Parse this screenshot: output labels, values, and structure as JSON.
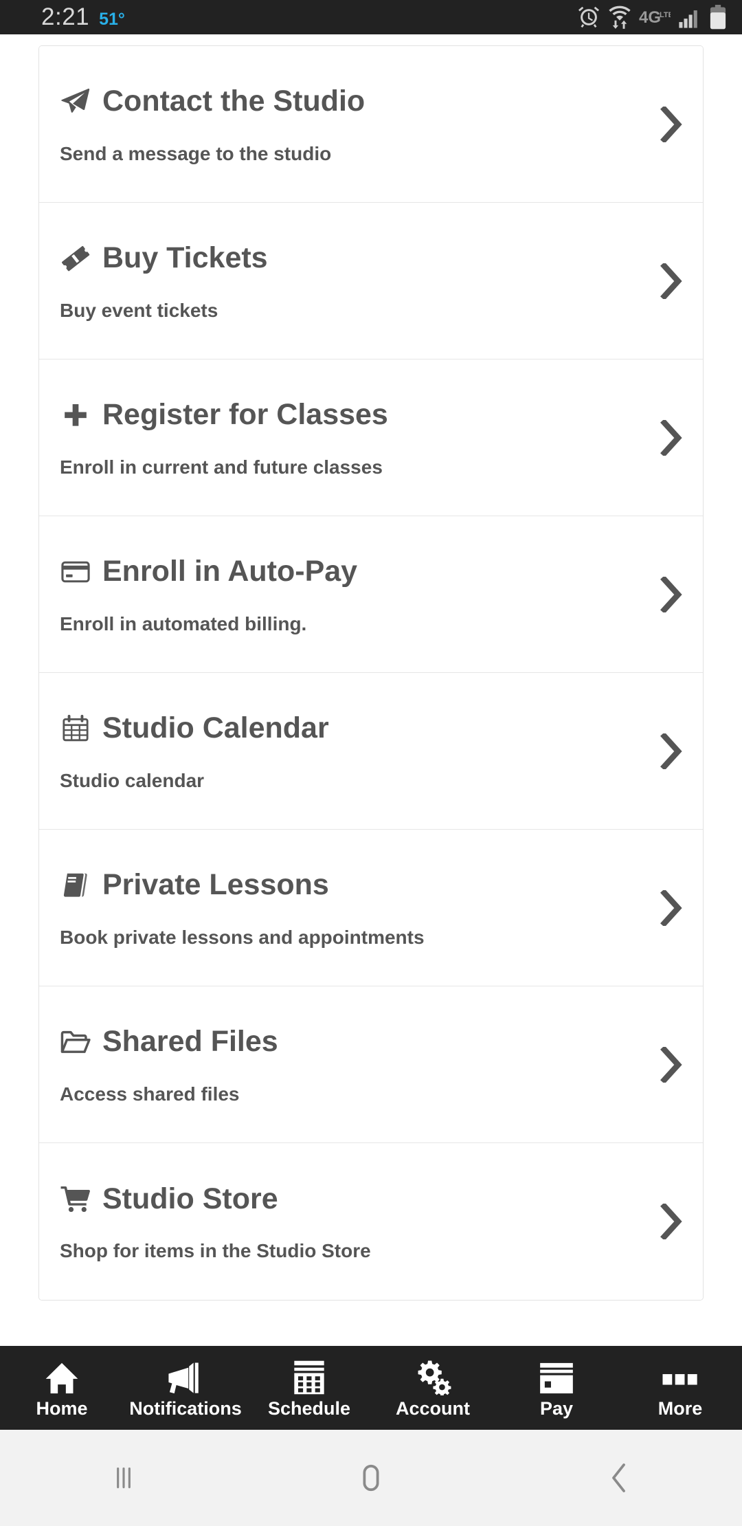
{
  "status_bar": {
    "time": "2:21",
    "temperature": "51°",
    "time_color": "#d8d8d8",
    "temp_color": "#29b0e8",
    "background": "#222222",
    "icons": [
      "alarm-clock-icon",
      "wifi-data-transfer-icon",
      "4g-lte-icon",
      "cellular-signal-icon",
      "battery-icon"
    ]
  },
  "menu": {
    "items": [
      {
        "icon": "paper-plane-icon",
        "title": "Contact the Studio",
        "subtitle": "Send a message to the studio",
        "chevron": "chevron-right-icon"
      },
      {
        "icon": "ticket-icon",
        "title": "Buy Tickets",
        "subtitle": "Buy event tickets",
        "chevron": "chevron-right-icon"
      },
      {
        "icon": "plus-icon",
        "title": "Register for Classes",
        "subtitle": "Enroll in current and future classes",
        "chevron": "chevron-right-icon"
      },
      {
        "icon": "credit-card-icon",
        "title": "Enroll in Auto-Pay",
        "subtitle": "Enroll in automated billing.",
        "chevron": "chevron-right-icon"
      },
      {
        "icon": "calendar-icon",
        "title": "Studio Calendar",
        "subtitle": "Studio calendar",
        "chevron": "chevron-right-icon"
      },
      {
        "icon": "book-icon",
        "title": "Private Lessons",
        "subtitle": "Book private lessons and appointments",
        "chevron": "chevron-right-icon"
      },
      {
        "icon": "open-folder-icon",
        "title": "Shared Files",
        "subtitle": "Access shared files",
        "chevron": "chevron-right-icon"
      },
      {
        "icon": "shopping-cart-icon",
        "title": "Studio Store",
        "subtitle": "Shop for items in the Studio Store",
        "chevron": "chevron-right-icon"
      }
    ],
    "text_color": "#555555",
    "card_border_color": "#e2e2e2"
  },
  "tab_bar": {
    "background": "#222222",
    "label_color": "#ffffff",
    "items": [
      {
        "icon": "home-icon",
        "label": "Home"
      },
      {
        "icon": "megaphone-icon",
        "label": "Notifications"
      },
      {
        "icon": "schedule-grid-icon",
        "label": "Schedule"
      },
      {
        "icon": "gears-icon",
        "label": "Account"
      },
      {
        "icon": "payment-card-icon",
        "label": "Pay"
      },
      {
        "icon": "more-dots-icon",
        "label": "More"
      }
    ]
  },
  "android_nav": {
    "background": "#f2f2f2",
    "buttons": [
      {
        "icon": "recents-icon"
      },
      {
        "icon": "home-circle-icon"
      },
      {
        "icon": "back-chevron-icon"
      }
    ]
  }
}
